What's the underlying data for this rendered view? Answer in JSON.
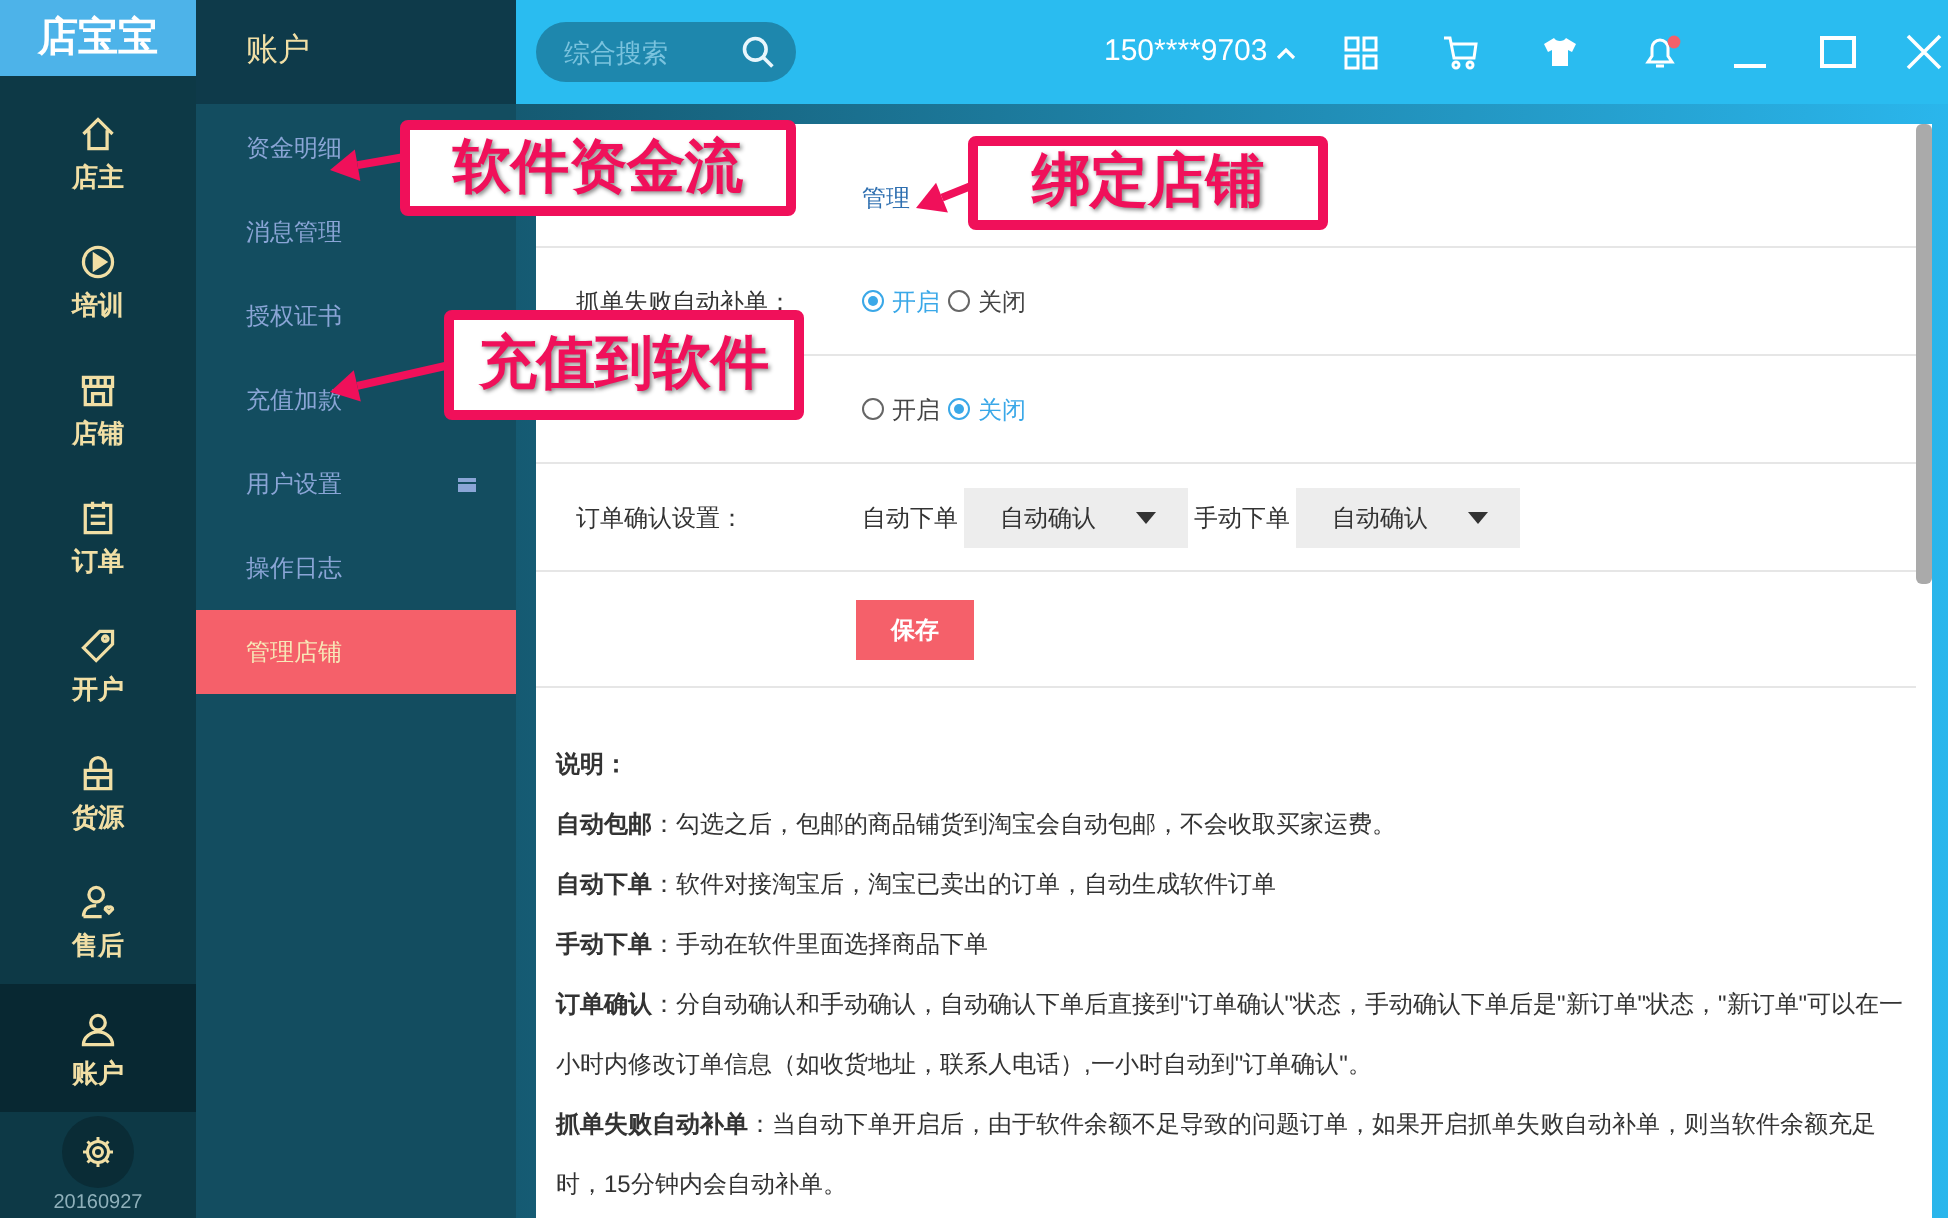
{
  "logo": "店宝宝",
  "rail": [
    {
      "label": "店主",
      "selected": false
    },
    {
      "label": "培训",
      "selected": false
    },
    {
      "label": "店铺",
      "selected": false
    },
    {
      "label": "订单",
      "selected": false
    },
    {
      "label": "开户",
      "selected": false
    },
    {
      "label": "货源",
      "selected": false
    },
    {
      "label": "售后",
      "selected": false
    },
    {
      "label": "账户",
      "selected": true
    }
  ],
  "version": "20160927",
  "sidebar": {
    "title": "账户",
    "items": [
      {
        "label": "资金明细",
        "selected": false,
        "kind": "plain"
      },
      {
        "label": "消息管理",
        "selected": false,
        "kind": "plain"
      },
      {
        "label": "授权证书",
        "selected": false,
        "kind": "plain"
      },
      {
        "label": "充值加款",
        "selected": false,
        "kind": "plain"
      },
      {
        "label": "用户设置",
        "selected": false,
        "kind": "menu"
      },
      {
        "label": "操作日志",
        "selected": false,
        "kind": "plain"
      },
      {
        "label": "管理店铺",
        "selected": true,
        "kind": "plain"
      }
    ]
  },
  "topbar": {
    "search_placeholder": "综合搜索",
    "account": "150****9703"
  },
  "content": {
    "shop_link": "管理",
    "settings": [
      {
        "kind": "radio",
        "label": "抓单失败自动补单：",
        "options": [
          {
            "label": "开启",
            "selected": true
          },
          {
            "label": "关闭",
            "selected": false
          }
        ]
      },
      {
        "kind": "radio",
        "options": [
          {
            "label": "开启",
            "selected": false
          },
          {
            "label": "关闭",
            "selected": true
          }
        ]
      },
      {
        "kind": "selects",
        "label": "订单确认设置：",
        "groups": [
          {
            "label": "自动下单",
            "value": "自动确认"
          },
          {
            "label": "手动下单",
            "value": "自动确认"
          }
        ]
      }
    ],
    "save_button": "保存",
    "notes_title": "说明：",
    "notes": [
      "**自动包邮**：勾选之后，包邮的商品铺货到淘宝会自动包邮，不会收取买家运费。",
      "**自动下单**：软件对接淘宝后，淘宝已卖出的订单，自动生成软件订单",
      "**手动下单**：手动在软件里面选择商品下单",
      "**订单确认**：分自动确认和手动确认，自动确认下单后直接到\"订单确认\"状态，手动确认下单后是\"新订单\"状态，\"新订单\"可以在一小时内修改订单信息（如收货地址，联系人电话）,一小时自动到\"订单确认\"。",
      "**抓单失败自动补单**：当自动下单开启后，由于软件余额不足导致的问题订单，如果开启抓单失败自动补单，则当软件余额充足时，15分钟内会自动补单。"
    ]
  },
  "annotations": [
    {
      "text": "软件资金流"
    },
    {
      "text": "充值到软件"
    },
    {
      "text": "绑定店铺"
    }
  ]
}
